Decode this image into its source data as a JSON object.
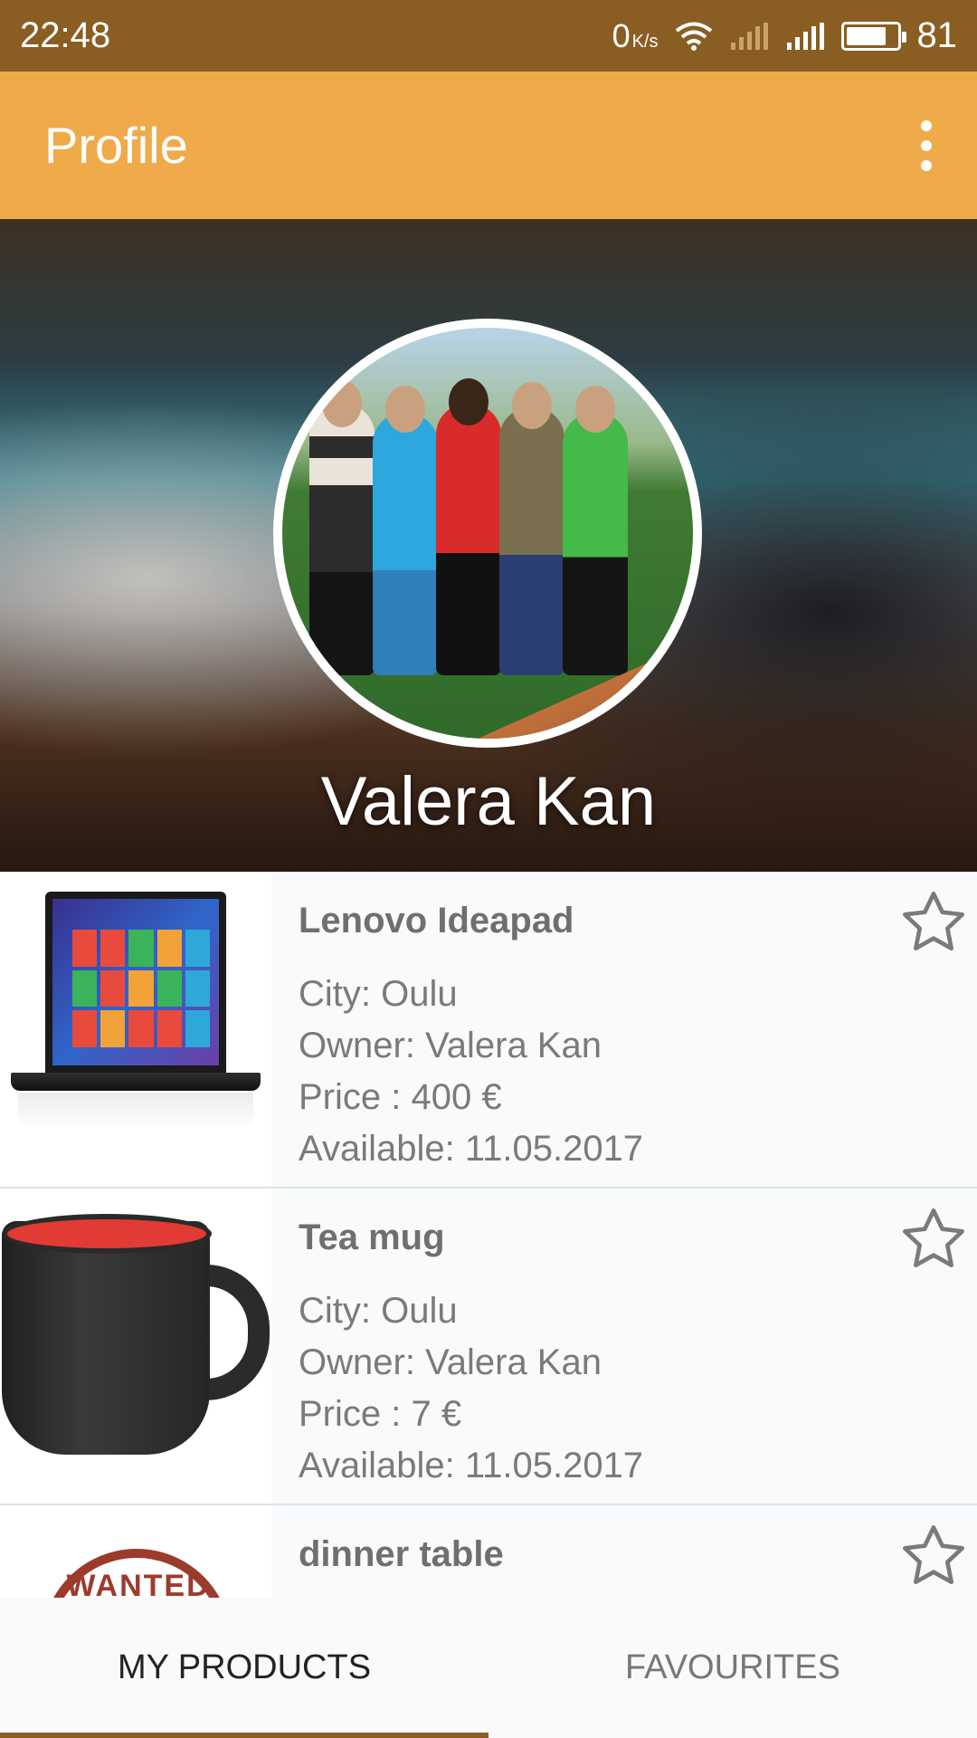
{
  "status_bar": {
    "time": "22:48",
    "net_speed_value": "0",
    "net_speed_unit": "K/s",
    "battery": "81",
    "icons": [
      "wifi-icon",
      "signal-sim2-icon",
      "signal-icon",
      "battery-icon"
    ]
  },
  "app_bar": {
    "title": "Profile",
    "menu_icon": "more-vert-icon",
    "background_color": "#efaa4a",
    "status_color": "#8a5e22"
  },
  "profile": {
    "name": "Valera Kan"
  },
  "products": [
    {
      "title": "Lenovo Ideapad",
      "city": "City: Oulu",
      "owner": "Owner: Valera Kan",
      "price": "Price : 400 €",
      "available": "Available: 11.05.2017",
      "favourite": false
    },
    {
      "title": "Tea mug",
      "city": "City: Oulu",
      "owner": "Owner: Valera Kan",
      "price": "Price : 7 €",
      "available": "Available: 11.05.2017",
      "favourite": false
    },
    {
      "title": "dinner table",
      "stamp_text": "WANTED",
      "favourite": false
    }
  ],
  "tabs": [
    {
      "label": "MY PRODUCTS",
      "active": true
    },
    {
      "label": "FAVOURITES",
      "active": false
    }
  ]
}
